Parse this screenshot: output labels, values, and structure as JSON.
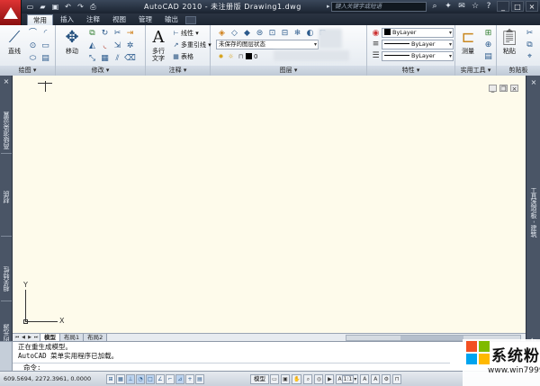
{
  "titlebar": {
    "title": "AutoCAD 2010 - 未注册版  Drawing1.dwg",
    "search_placeholder": "键入关键字或短语",
    "quick_access": [
      "new-icon",
      "open-icon",
      "save-icon",
      "undo-icon",
      "redo-icon",
      "print-icon"
    ],
    "window_controls": [
      "_",
      "□",
      "×"
    ]
  },
  "tabs": [
    "常用",
    "插入",
    "注释",
    "视图",
    "管理",
    "输出"
  ],
  "active_tab": "常用",
  "panels": {
    "draw": {
      "label": "绘图",
      "line_label": "直线"
    },
    "modify": {
      "label": "修改",
      "move_label": "移动"
    },
    "annotation": {
      "label": "注释",
      "mtext_label": "多行",
      "mtext_label2": "文字",
      "linear_label": "线性",
      "mleader_label": "多重引线",
      "table_label": "表格"
    },
    "layers": {
      "label": "图层",
      "state_combo": "未保存的图层状态",
      "layer_combo": "0"
    },
    "properties": {
      "label": "特性",
      "color_combo": "ByLayer",
      "linetype_combo": "ByLayer",
      "lineweight_combo": "ByLayer"
    },
    "utilities": {
      "label": "实用工具",
      "measure_label": "测量"
    },
    "clipboard": {
      "label": "剪贴板",
      "paste_label": "粘贴"
    }
  },
  "left_palettes": [
    "高级渲染设置",
    "材质",
    "相关特性",
    "模型中的光源"
  ],
  "right_palettes": [
    "工具选项板 - 建筑"
  ],
  "canvas": {
    "ucs_x": "X",
    "ucs_y": "Y",
    "background": "#fefbeb"
  },
  "layout_tabs": [
    "模型",
    "布局1",
    "布局2"
  ],
  "active_layout": "模型",
  "command": {
    "lines": [
      "正在重生成模型。",
      "AutoCAD 菜单实用程序已加载。"
    ],
    "prompt": "命令:"
  },
  "statusbar": {
    "coordinates": "609.5694,  2272.3961, 0.0000",
    "model_label": "模型",
    "scale_label": "1:1"
  },
  "watermark": {
    "text": "系统粉",
    "url": "www.win7999.com"
  }
}
